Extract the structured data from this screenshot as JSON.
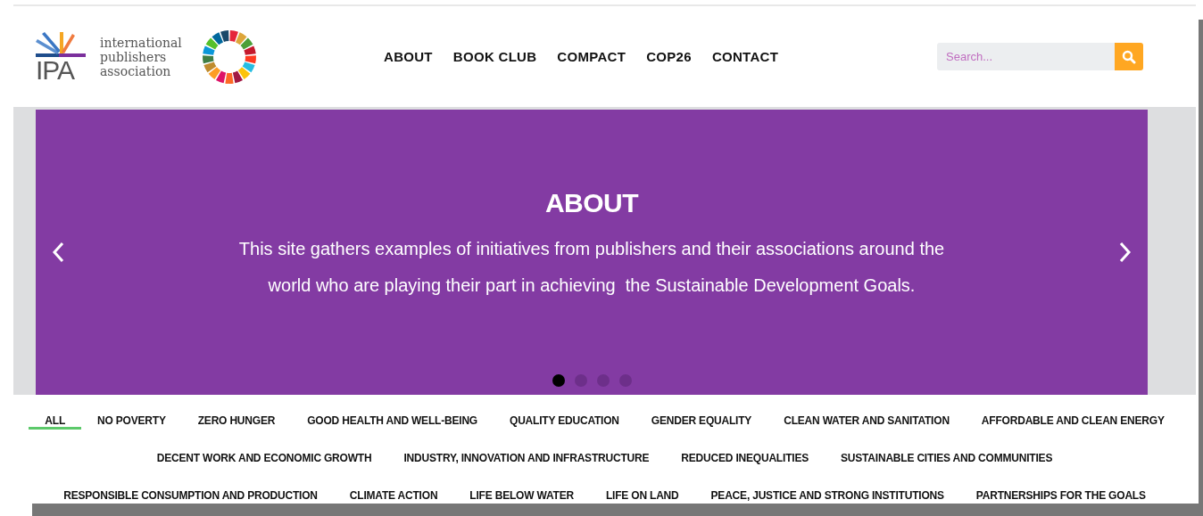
{
  "logo": {
    "abbr": "IPA",
    "name": "international publishers association"
  },
  "nav": [
    {
      "label": "ABOUT"
    },
    {
      "label": "BOOK CLUB"
    },
    {
      "label": "COMPACT"
    },
    {
      "label": "COP26"
    },
    {
      "label": "CONTACT"
    }
  ],
  "search": {
    "placeholder": "Search..."
  },
  "slider": {
    "title": "ABOUT",
    "text": "This site gathers examples of initiatives from publishers and their associations around the world who are playing their part in achieving  the Sustainable Development Goals.",
    "dots": [
      {
        "selected": true
      },
      {
        "selected": false
      },
      {
        "selected": false
      },
      {
        "selected": false
      }
    ]
  },
  "filter_rows": [
    [
      {
        "label": "ALL",
        "selected": true
      },
      {
        "label": "NO POVERTY",
        "selected": false
      },
      {
        "label": "ZERO HUNGER",
        "selected": false
      },
      {
        "label": "GOOD HEALTH AND WELL-BEING",
        "selected": false
      },
      {
        "label": "QUALITY EDUCATION",
        "selected": false
      },
      {
        "label": "GENDER EQUALITY",
        "selected": false
      },
      {
        "label": "CLEAN WATER AND SANITATION",
        "selected": false
      },
      {
        "label": "AFFORDABLE AND CLEAN ENERGY",
        "selected": false
      }
    ],
    [
      {
        "label": "DECENT WORK AND ECONOMIC GROWTH",
        "selected": false
      },
      {
        "label": "INDUSTRY, INNOVATION AND INFRASTRUCTURE",
        "selected": false
      },
      {
        "label": "REDUCED INEQUALITIES",
        "selected": false
      },
      {
        "label": "SUSTAINABLE CITIES AND COMMUNITIES",
        "selected": false
      }
    ],
    [
      {
        "label": "RESPONSIBLE CONSUMPTION AND PRODUCTION",
        "selected": false
      },
      {
        "label": "CLIMATE ACTION",
        "selected": false
      },
      {
        "label": "LIFE BELOW WATER",
        "selected": false
      },
      {
        "label": "LIFE ON LAND",
        "selected": false
      },
      {
        "label": "PEACE, JUSTICE AND STRONG INSTITUTIONS",
        "selected": false
      },
      {
        "label": "PARTNERSHIPS FOR THE GOALS",
        "selected": false
      }
    ]
  ]
}
